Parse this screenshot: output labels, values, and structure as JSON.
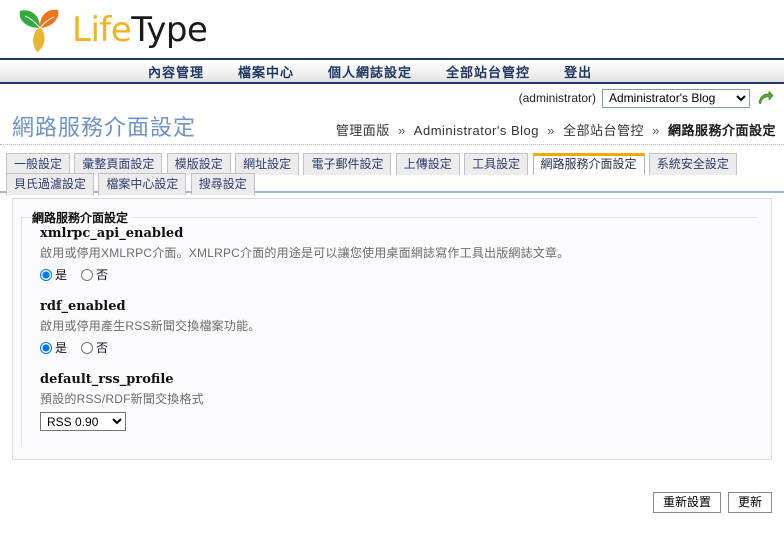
{
  "brand": {
    "name_part1": "Life",
    "name_part2": "Type",
    "logo_icon": "leaf-logo-icon",
    "colors": {
      "life": "#f0b323",
      "type": "#1a1a1a",
      "leaf_green": "#36a93b",
      "leaf_orange": "#f0751a",
      "leaf_yellow": "#e8b631"
    }
  },
  "topnav": {
    "items": [
      {
        "label": "內容管理",
        "name": "nav-content-management"
      },
      {
        "label": "檔案中心",
        "name": "nav-file-center"
      },
      {
        "label": "個人網誌設定",
        "name": "nav-personal-blog-settings"
      },
      {
        "label": "全部站台管控",
        "name": "nav-site-admin"
      },
      {
        "label": "登出",
        "name": "nav-logout"
      }
    ]
  },
  "blogbar": {
    "user_label": "(administrator)",
    "selected_blog": "Administrator's Blog",
    "blog_options": [
      "Administrator's Blog"
    ],
    "go_icon": "green-arrow-go-icon"
  },
  "page": {
    "title": "網路服務介面設定",
    "title_color": "#6f93c6"
  },
  "breadcrumb": {
    "items": [
      {
        "label": "管理面版",
        "current": false
      },
      {
        "label": "Administrator's Blog",
        "current": false
      },
      {
        "label": "全部站台管控",
        "current": false
      },
      {
        "label": "網路服務介面設定",
        "current": true
      }
    ],
    "separator": "»"
  },
  "tabs": {
    "active_index": 7,
    "active_top_color": "#f2a900",
    "items": [
      {
        "label": "一般設定",
        "name": "tab-general-settings"
      },
      {
        "label": "彙整頁面設定",
        "name": "tab-archive-page-settings"
      },
      {
        "label": "模版設定",
        "name": "tab-template-settings"
      },
      {
        "label": "網址設定",
        "name": "tab-url-settings"
      },
      {
        "label": "電子郵件設定",
        "name": "tab-email-settings"
      },
      {
        "label": "上傳設定",
        "name": "tab-upload-settings"
      },
      {
        "label": "工具設定",
        "name": "tab-tool-settings"
      },
      {
        "label": "網路服務介面設定",
        "name": "tab-web-service-settings"
      },
      {
        "label": "系統安全設定",
        "name": "tab-system-security-settings"
      },
      {
        "label": "貝氏過濾設定",
        "name": "tab-bayesian-filter-settings"
      },
      {
        "label": "檔案中心設定",
        "name": "tab-file-center-settings"
      },
      {
        "label": "搜尋設定",
        "name": "tab-search-settings"
      }
    ]
  },
  "settings": {
    "legend": "網路服務介面設定",
    "fields": [
      {
        "name": "xmlrpc_api_enabled",
        "description": "啟用或停用XMLRPC介面。XMLRPC介面的用途是可以讓您使用桌面網誌寫作工具出版網誌文章。",
        "type": "radio",
        "options": [
          {
            "label": "是",
            "value": "yes",
            "checked": true
          },
          {
            "label": "否",
            "value": "no",
            "checked": false
          }
        ]
      },
      {
        "name": "rdf_enabled",
        "description": "啟用或停用產生RSS新聞交換檔案功能。",
        "type": "radio",
        "options": [
          {
            "label": "是",
            "value": "yes",
            "checked": true
          },
          {
            "label": "否",
            "value": "no",
            "checked": false
          }
        ]
      },
      {
        "name": "default_rss_profile",
        "description": "預設的RSS/RDF新聞交換格式",
        "type": "select",
        "selected": "RSS 0.90",
        "options": [
          "RSS 0.90"
        ]
      }
    ]
  },
  "footer": {
    "reset_label": "重新設置",
    "update_label": "更新"
  }
}
